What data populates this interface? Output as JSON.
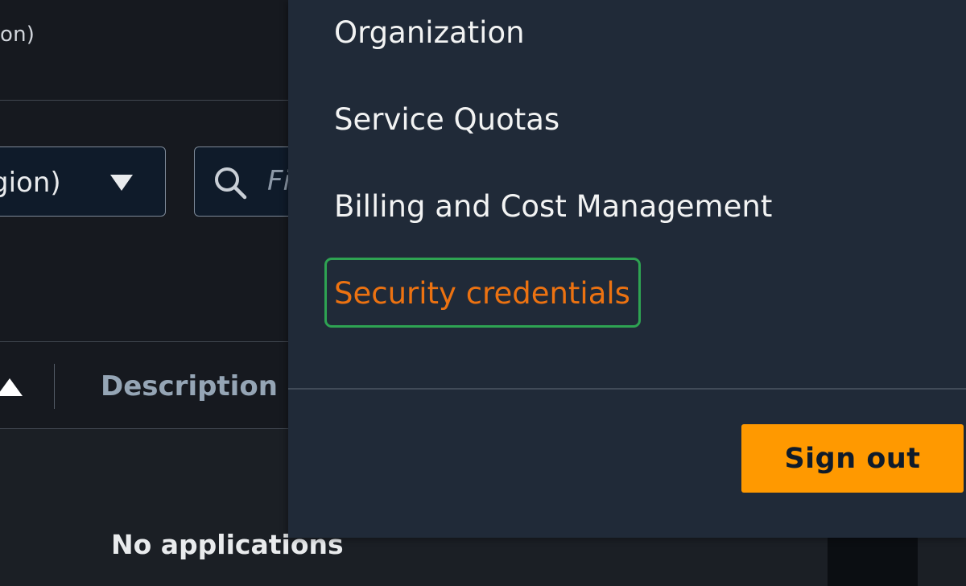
{
  "background": {
    "top_text": "on)",
    "region_select_value": "gion)",
    "search_placeholder": "Fi",
    "table_header": {
      "description": "Description"
    },
    "empty_state_text": "No applications"
  },
  "account_menu": {
    "items": [
      {
        "label": "Organization"
      },
      {
        "label": "Service Quotas"
      },
      {
        "label": "Billing and Cost Management"
      },
      {
        "label": "Security credentials",
        "highlighted": true
      }
    ],
    "sign_out_label": "Sign out"
  },
  "colors": {
    "accent": "#ff9900",
    "active_link": "#ec7211",
    "highlight_border": "#2ea352",
    "panel_bg": "#202a38",
    "page_bg": "#16191f"
  },
  "icons": {
    "search": "search-icon",
    "dropdown": "caret-down-icon",
    "sort": "sort-ascending-icon"
  }
}
